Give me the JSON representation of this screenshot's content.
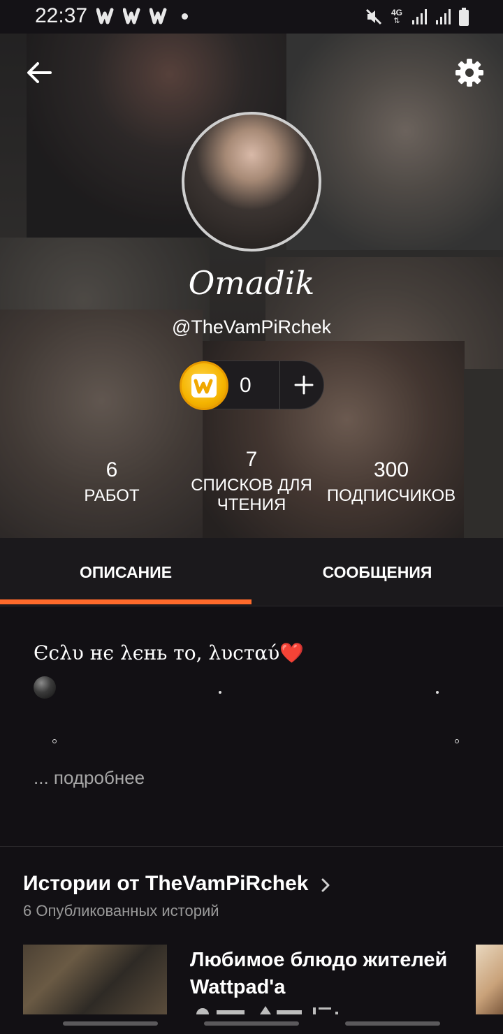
{
  "status_bar": {
    "time": "22:37",
    "notification_icons": [
      "wattpad-icon",
      "wattpad-icon",
      "wattpad-icon"
    ],
    "right_icons": [
      "mute-icon",
      "4g-icon",
      "signal-icon",
      "signal-icon",
      "battery-icon"
    ],
    "network_label": "4G"
  },
  "profile": {
    "display_name": "Omadik",
    "username": "@TheVamPiRchek",
    "coins": "0",
    "stats": [
      {
        "value": "6",
        "label": "РАБОТ"
      },
      {
        "value": "7",
        "label": "СПИСКОВ ДЛЯ ЧТЕНИЯ"
      },
      {
        "value": "300",
        "label": "ПОДПИСЧИКОВ"
      }
    ]
  },
  "tabs": [
    {
      "label": "ОПИСАНИЕ",
      "active": true
    },
    {
      "label": "СООБЩЕНИЯ",
      "active": false
    }
  ],
  "description": {
    "line1": "Єсλυ нє λєнь то, λυстαύ",
    "heart": "❤️",
    "more": "... подробнее"
  },
  "stories": {
    "title": "Истории от TheVamPiRchek",
    "subtitle": "6 Опубликованных историй",
    "items": [
      {
        "title": "Любимое блюдо жителей  Wattpad'a"
      }
    ]
  },
  "colors": {
    "accent": "#ff6a2b",
    "background": "#121014",
    "tab_bar": "#1b191c",
    "coin": "#f5b400"
  }
}
